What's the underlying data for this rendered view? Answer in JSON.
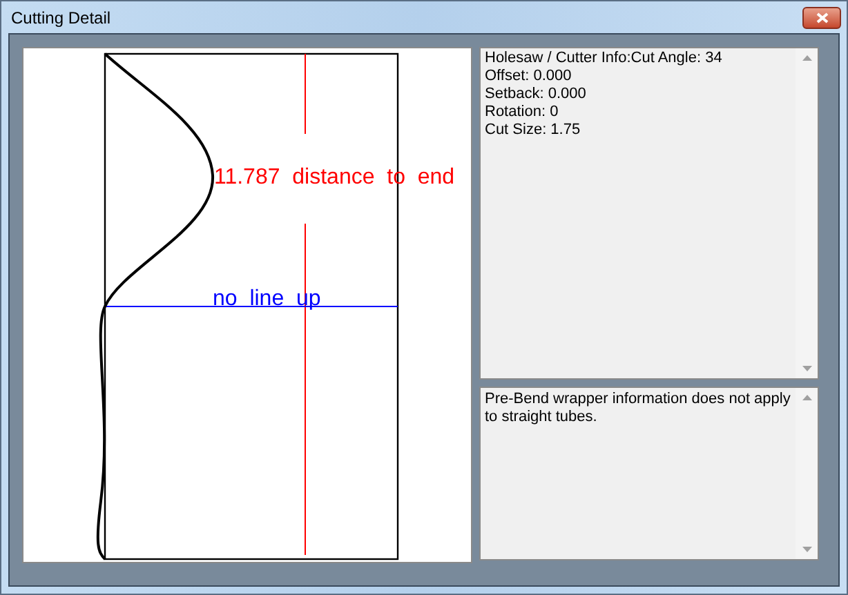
{
  "window": {
    "title": "Cutting Detail"
  },
  "drawing": {
    "distance_label": "11.787  distance  to  end",
    "lineup_label": "no  line  up"
  },
  "cutter_info": {
    "lines": [
      "Holesaw / Cutter Info:Cut Angle: 34",
      "Offset: 0.000",
      "Setback: 0.000",
      "Rotation: 0",
      "Cut Size: 1.75"
    ]
  },
  "wrapper_info": {
    "text": "Pre-Bend wrapper information does not apply to straight tubes."
  }
}
